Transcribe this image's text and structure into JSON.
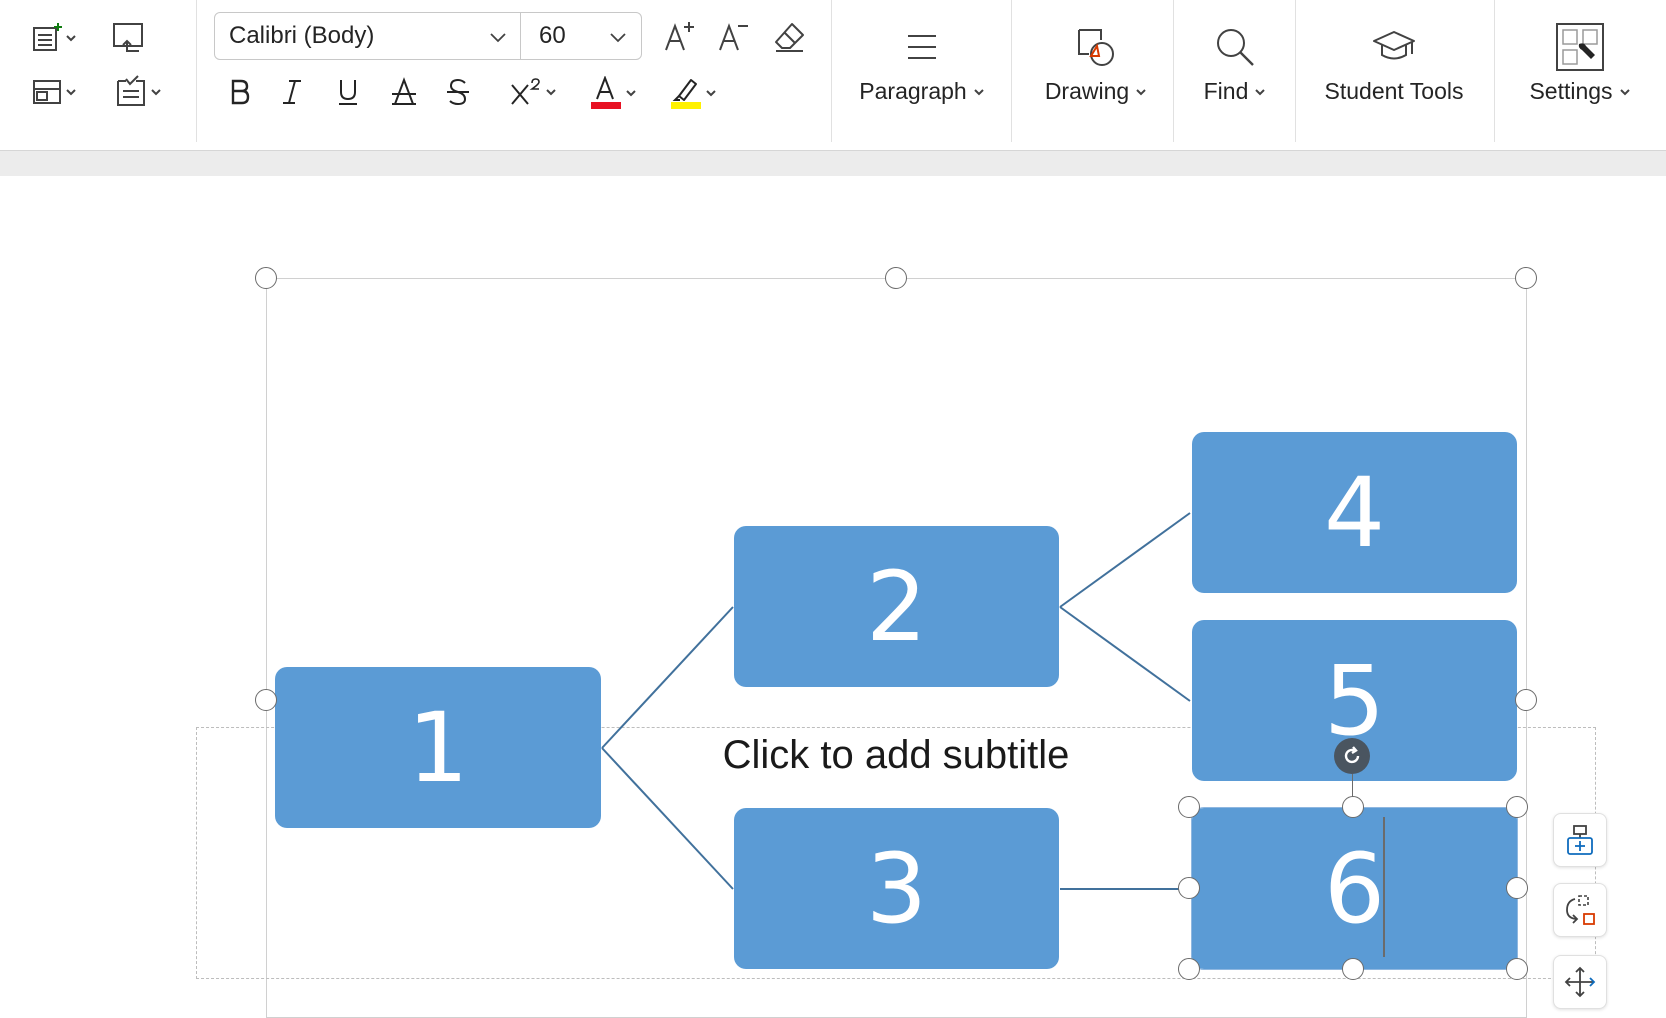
{
  "toolbar": {
    "font_name": "Calibri (Body)",
    "font_size": "60",
    "groups": {
      "paragraph": "Paragraph",
      "drawing": "Drawing",
      "find": "Find",
      "student_tools": "Student Tools",
      "settings": "Settings"
    },
    "colors": {
      "font_color": "#e81123",
      "highlight_color": "#fff100"
    }
  },
  "slide": {
    "subtitle_placeholder": "Click to add subtitle",
    "node_color": "#5b9bd5",
    "connector_color": "#41719c",
    "nodes": [
      "1",
      "2",
      "3",
      "4",
      "5",
      "6"
    ]
  }
}
